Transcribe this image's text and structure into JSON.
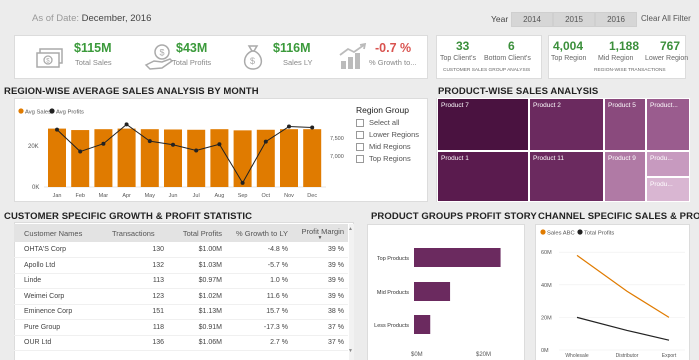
{
  "header": {
    "as_of_label": "As of Date:",
    "as_of_value": "December, 2016",
    "year_label": "Year",
    "years": [
      "2014",
      "2015",
      "2016"
    ],
    "clear_filter": "Clear All Filter"
  },
  "kpis": [
    {
      "value": "$115M",
      "label": "Total Sales",
      "color": "#3b9a3b",
      "icon": "money-bill-icon"
    },
    {
      "value": "$43M",
      "label": "Total Profits",
      "color": "#3b9a3b",
      "icon": "hand-coin-icon"
    },
    {
      "value": "$116M",
      "label": "Sales LY",
      "color": "#3b9a3b",
      "icon": "money-bag-icon"
    },
    {
      "value": "-0.7 %",
      "label": "% Growth to...",
      "color": "#d9534f",
      "icon": "growth-chart-icon"
    }
  ],
  "client_stats": {
    "values": [
      {
        "value": "33",
        "label": "Top Client's"
      },
      {
        "value": "6",
        "label": "Bottom Client's"
      }
    ],
    "caption": "CUSTOMER SALES GROUP ANALYSIS"
  },
  "region_stats": {
    "values": [
      {
        "value": "4,004",
        "label": "Top Region"
      },
      {
        "value": "1,188",
        "label": "Mid Region"
      },
      {
        "value": "767",
        "label": "Lower Region"
      }
    ],
    "caption": "REGION-WISE TRANSACTIONS"
  },
  "region_chart": {
    "title": "REGION-WISE AVERAGE SALES ANALYSIS BY MONTH",
    "legend": [
      "Avg Sales",
      "Avg Profits"
    ],
    "left_ticks": [
      "20K",
      "0K"
    ],
    "right_ticks": [
      "7,500",
      "7,000"
    ],
    "filter_title": "Region Group",
    "filter_options": [
      "Select all",
      "Lower Regions",
      "Mid Regions",
      "Top Regions"
    ]
  },
  "product_chart": {
    "title": "PRODUCT-WISE SALES ANALYSIS",
    "tiles": [
      "Product 7",
      "Product 2",
      "Product 5",
      "Product...",
      "Product 1",
      "Product 11",
      "Product 9",
      "Produ...",
      "Produ..."
    ]
  },
  "customer_table": {
    "title": "CUSTOMER SPECIFIC GROWTH & PROFIT STATISTIC",
    "headers": [
      "Customer Names",
      "Transactions",
      "Total Profits",
      "% Growth to LY",
      "Profit Margin"
    ],
    "rows": [
      {
        "name": "OHTA'S Corp",
        "tx": "130",
        "profit": "$1.00M",
        "growth": "-4.8 %",
        "margin": "39 %",
        "pc": "normal",
        "gc": "normal",
        "mc": "green"
      },
      {
        "name": "Apollo Ltd",
        "tx": "132",
        "profit": "$1.03M",
        "growth": "-5.7 %",
        "margin": "39 %",
        "pc": "normal",
        "gc": "normal",
        "mc": "green"
      },
      {
        "name": "Linde",
        "tx": "113",
        "profit": "$0.97M",
        "growth": "1.0 %",
        "margin": "39 %",
        "pc": "red",
        "gc": "normal",
        "mc": "green"
      },
      {
        "name": "Weimei Corp",
        "tx": "123",
        "profit": "$1.02M",
        "growth": "11.6 %",
        "margin": "39 %",
        "pc": "normal",
        "gc": "green",
        "mc": "green"
      },
      {
        "name": "Eminence Corp",
        "tx": "151",
        "profit": "$1.13M",
        "growth": "15.7 %",
        "margin": "38 %",
        "pc": "green",
        "gc": "green",
        "mc": "normal"
      },
      {
        "name": "Pure Group",
        "tx": "118",
        "profit": "$0.91M",
        "growth": "-17.3 %",
        "margin": "37 %",
        "pc": "red",
        "gc": "red",
        "mc": "red"
      },
      {
        "name": "OUR Ltd",
        "tx": "136",
        "profit": "$1.06M",
        "growth": "2.7 %",
        "margin": "37 %",
        "pc": "green",
        "gc": "normal",
        "mc": "red"
      }
    ]
  },
  "product_groups": {
    "title": "PRODUCT GROUPS PROFIT STORY",
    "categories": [
      "Top Products",
      "Mid Products",
      "Less Products"
    ],
    "x_ticks": [
      "$0M",
      "$20M"
    ]
  },
  "channel": {
    "title": "CHANNEL SPECIFIC SALES & PROFIT",
    "legend": [
      "Sales ABC",
      "Total Profits"
    ],
    "y_ticks": [
      "60M",
      "40M",
      "20M",
      "0M"
    ],
    "x_ticks": [
      "Wholesale",
      "Distributor",
      "Export"
    ]
  },
  "colors": {
    "orange": "#e07b00",
    "dark": "#222222",
    "plum_dark": "#4a1240",
    "plum": "#6b2a5f",
    "plum_mid": "#8a4a7d",
    "plum_light": "#b07aa5",
    "plum_pale": "#d9b6d2"
  },
  "chart_data": [
    {
      "type": "bar",
      "title": "REGION-WISE AVERAGE SALES ANALYSIS BY MONTH",
      "categories": [
        "Jan",
        "Feb",
        "Mar",
        "Apr",
        "May",
        "Jun",
        "Jul",
        "Aug",
        "Sep",
        "Oct",
        "Nov",
        "Dec"
      ],
      "series": [
        {
          "name": "Avg Sales",
          "type": "bar",
          "axis": "left",
          "values": [
            20000,
            19500,
            19800,
            20000,
            19800,
            19700,
            19600,
            19800,
            19400,
            19600,
            19800,
            19800
          ]
        },
        {
          "name": "Avg Profits",
          "type": "line",
          "axis": "right",
          "values": [
            7500,
            7080,
            7230,
            7600,
            7280,
            7210,
            7100,
            7220,
            6480,
            7270,
            7560,
            7540
          ]
        }
      ],
      "ylim_left": [
        0,
        25000
      ],
      "ylim_right": [
        6400,
        7800
      ]
    },
    {
      "type": "bar",
      "title": "PRODUCT GROUPS PROFIT STORY",
      "orientation": "horizontal",
      "categories": [
        "Top Products",
        "Mid Products",
        "Less Products"
      ],
      "values": [
        24,
        10,
        4.5
      ],
      "xlim": [
        0,
        28
      ]
    },
    {
      "type": "line",
      "title": "CHANNEL SPECIFIC SALES & PROFIT",
      "categories": [
        "Wholesale",
        "Distributor",
        "Export"
      ],
      "series": [
        {
          "name": "Sales ABC",
          "values": [
            58,
            36,
            20
          ]
        },
        {
          "name": "Total Profits",
          "values": [
            20,
            12,
            6
          ]
        }
      ],
      "ylim": [
        0,
        65
      ]
    }
  ]
}
